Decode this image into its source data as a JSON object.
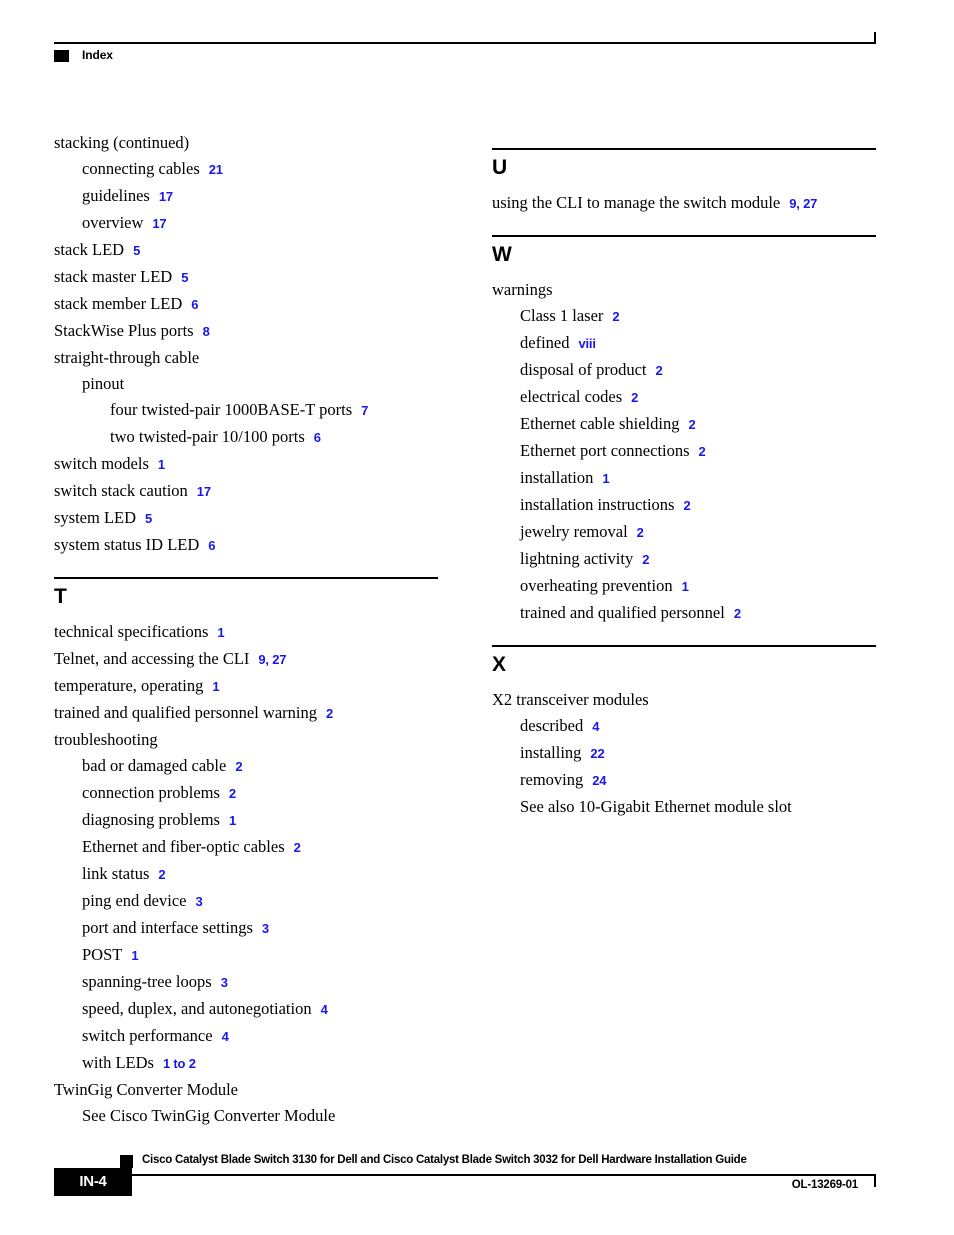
{
  "header": {
    "title": "Index",
    "marker_icon": "black-square-marker"
  },
  "left_column": {
    "sections": [
      {
        "letter": null,
        "has_divider": false,
        "entries": [
          {
            "level": 0,
            "text": "stacking (continued)",
            "pages": ""
          },
          {
            "level": 1,
            "text": "connecting cables",
            "pages": "21"
          },
          {
            "level": 1,
            "text": "guidelines",
            "pages": "17"
          },
          {
            "level": 1,
            "text": "overview",
            "pages": "17"
          },
          {
            "level": 0,
            "text": "stack LED",
            "pages": "5"
          },
          {
            "level": 0,
            "text": "stack master LED",
            "pages": "5"
          },
          {
            "level": 0,
            "text": "stack member LED",
            "pages": "6"
          },
          {
            "level": 0,
            "text": "StackWise Plus ports",
            "pages": "8"
          },
          {
            "level": 0,
            "text": "straight-through cable",
            "pages": ""
          },
          {
            "level": 1,
            "text": "pinout",
            "pages": ""
          },
          {
            "level": 2,
            "text": "four twisted-pair 1000BASE-T ports",
            "pages": "7"
          },
          {
            "level": 2,
            "text": "two twisted-pair 10/100 ports",
            "pages": "6"
          },
          {
            "level": 0,
            "text": "switch models",
            "pages": "1"
          },
          {
            "level": 0,
            "text": "switch stack caution",
            "pages": "17"
          },
          {
            "level": 0,
            "text": "system LED",
            "pages": "5"
          },
          {
            "level": 0,
            "text": "system status ID LED",
            "pages": "6"
          }
        ]
      },
      {
        "letter": "T",
        "has_divider": true,
        "entries": [
          {
            "level": 0,
            "text": "technical specifications",
            "pages": "1"
          },
          {
            "level": 0,
            "text": "Telnet, and accessing the CLI",
            "pages": "9, 27"
          },
          {
            "level": 0,
            "text": "temperature, operating",
            "pages": "1"
          },
          {
            "level": 0,
            "text": "trained and qualified personnel warning",
            "pages": "2"
          },
          {
            "level": 0,
            "text": "troubleshooting",
            "pages": ""
          },
          {
            "level": 1,
            "text": "bad or damaged cable",
            "pages": "2"
          },
          {
            "level": 1,
            "text": "connection problems",
            "pages": "2"
          },
          {
            "level": 1,
            "text": "diagnosing problems",
            "pages": "1"
          },
          {
            "level": 1,
            "text": "Ethernet and fiber-optic cables",
            "pages": "2"
          },
          {
            "level": 1,
            "text": "link status",
            "pages": "2"
          },
          {
            "level": 1,
            "text": "ping end device",
            "pages": "3"
          },
          {
            "level": 1,
            "text": "port and interface settings",
            "pages": "3"
          },
          {
            "level": 1,
            "text": "POST",
            "pages": "1"
          },
          {
            "level": 1,
            "text": "spanning-tree loops",
            "pages": "3"
          },
          {
            "level": 1,
            "text": "speed, duplex, and autonegotiation",
            "pages": "4"
          },
          {
            "level": 1,
            "text": "switch performance",
            "pages": "4"
          },
          {
            "level": 1,
            "text": "with LEDs",
            "pages": "1 to 2"
          },
          {
            "level": 0,
            "text": "TwinGig Converter Module",
            "pages": ""
          },
          {
            "level": 1,
            "text": "See Cisco TwinGig Converter Module",
            "pages": ""
          }
        ]
      }
    ]
  },
  "right_column": {
    "sections": [
      {
        "letter": "U",
        "has_divider": true,
        "entries": [
          {
            "level": 0,
            "text": "using the CLI to manage the switch module",
            "pages": "9, 27"
          }
        ]
      },
      {
        "letter": "W",
        "has_divider": true,
        "entries": [
          {
            "level": 0,
            "text": "warnings",
            "pages": ""
          },
          {
            "level": 1,
            "text": "Class 1 laser",
            "pages": "2"
          },
          {
            "level": 1,
            "text": "defined",
            "pages": "viii"
          },
          {
            "level": 1,
            "text": "disposal of product",
            "pages": "2"
          },
          {
            "level": 1,
            "text": "electrical codes",
            "pages": "2"
          },
          {
            "level": 1,
            "text": "Ethernet cable shielding",
            "pages": "2"
          },
          {
            "level": 1,
            "text": "Ethernet port connections",
            "pages": "2"
          },
          {
            "level": 1,
            "text": "installation",
            "pages": "1"
          },
          {
            "level": 1,
            "text": "installation instructions",
            "pages": "2"
          },
          {
            "level": 1,
            "text": "jewelry removal",
            "pages": "2"
          },
          {
            "level": 1,
            "text": "lightning activity",
            "pages": "2"
          },
          {
            "level": 1,
            "text": "overheating prevention",
            "pages": "1"
          },
          {
            "level": 1,
            "text": "trained and qualified personnel",
            "pages": "2"
          }
        ]
      },
      {
        "letter": "X",
        "has_divider": true,
        "entries": [
          {
            "level": 0,
            "text": "X2 transceiver modules",
            "pages": ""
          },
          {
            "level": 1,
            "text": "described",
            "pages": "4"
          },
          {
            "level": 1,
            "text": "installing",
            "pages": "22"
          },
          {
            "level": 1,
            "text": "removing",
            "pages": "24"
          },
          {
            "level": 1,
            "text": "See also 10-Gigabit Ethernet module slot",
            "pages": ""
          }
        ]
      }
    ]
  },
  "footer": {
    "document_title": "Cisco Catalyst Blade Switch 3130 for Dell and Cisco Catalyst Blade Switch 3032 for Dell Hardware Installation Guide",
    "page_number": "IN-4",
    "doc_id": "OL-13269-01",
    "marker_icon": "black-square-marker"
  },
  "colors": {
    "page_number_blue": "#1a17e8",
    "text_black": "#000000",
    "background": "#ffffff"
  }
}
